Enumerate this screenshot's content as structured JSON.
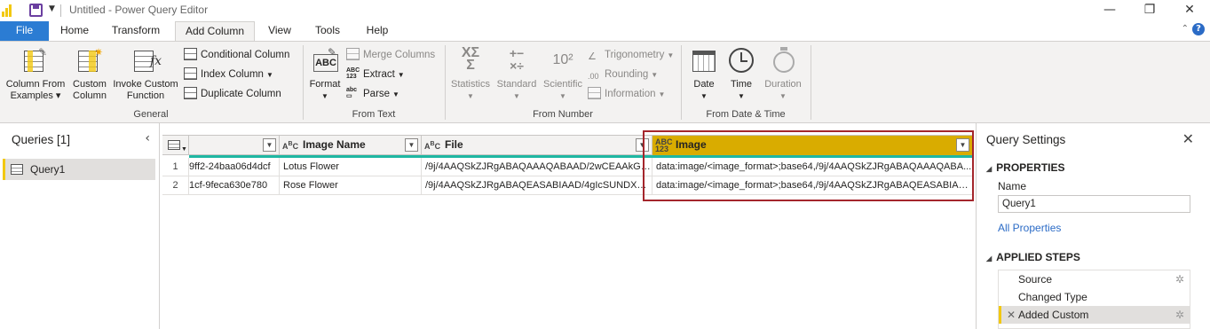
{
  "titlebar": {
    "title": "Untitled - Power Query Editor",
    "minimize": "—",
    "restore": "❐",
    "close": "✕"
  },
  "tabs": [
    "File",
    "Home",
    "Transform",
    "Add Column",
    "View",
    "Tools",
    "Help"
  ],
  "help_glyph": "?",
  "ribbon": {
    "general": {
      "label": "General",
      "col_from_examples": [
        "Column From",
        "Examples ▾"
      ],
      "custom_column": [
        "Custom",
        "Column"
      ],
      "invoke_custom": [
        "Invoke Custom",
        "Function"
      ],
      "conditional": "Conditional Column",
      "index": "Index Column",
      "duplicate": "Duplicate Column"
    },
    "from_text": {
      "label": "From Text",
      "format": "Format",
      "merge": "Merge Columns",
      "extract": "Extract",
      "parse": "Parse"
    },
    "from_number": {
      "label": "From Number",
      "statistics": "Statistics",
      "standard": "Standard",
      "scientific": "Scientific",
      "trigonometry": "Trigonometry",
      "rounding": "Rounding",
      "information": "Information"
    },
    "from_datetime": {
      "label": "From Date & Time",
      "date": "Date",
      "time": "Time",
      "duration": "Duration"
    }
  },
  "queries": {
    "title": "Queries [1]",
    "items": [
      "Query1"
    ]
  },
  "grid": {
    "columns": [
      {
        "name": "",
        "type": ""
      },
      {
        "name": "Image Name",
        "type": "ABC"
      },
      {
        "name": "File",
        "type": "ABC"
      },
      {
        "name": "Image",
        "type": "ABC 123"
      }
    ],
    "rows": [
      {
        "num": "1",
        "c0": "9ff2-24baa06d4dcf",
        "c1": "Lotus Flower",
        "c2": "/9j/4AAQSkZJRgABAQAAAQABAAD/2wCEAAkGBx...",
        "c3": "data:image/<image_format>;base64,/9j/4AAQSkZJRgABAQAAAQABA..."
      },
      {
        "num": "2",
        "c0": "1cf-9feca630e780",
        "c1": "Rose Flower",
        "c2": "/9j/4AAQSkZJRgABAQEASABIAAD/4gIcSUNDX1BS...",
        "c3": "data:image/<image_format>;base64,/9j/4AAQSkZJRgABAQEASABIAA..."
      }
    ]
  },
  "settings": {
    "title": "Query Settings",
    "properties_label": "PROPERTIES",
    "name_label": "Name",
    "name_value": "Query1",
    "all_properties": "All Properties",
    "applied_steps_label": "APPLIED STEPS",
    "steps": [
      "Source",
      "Changed Type",
      "Added Custom"
    ]
  },
  "colors": {
    "accent": "#F2C811",
    "file_tab": "#2b7cd3",
    "selected_header": "#d9ac00",
    "quality_bar": "#1fb7a2",
    "highlight_box": "#a4262c"
  }
}
